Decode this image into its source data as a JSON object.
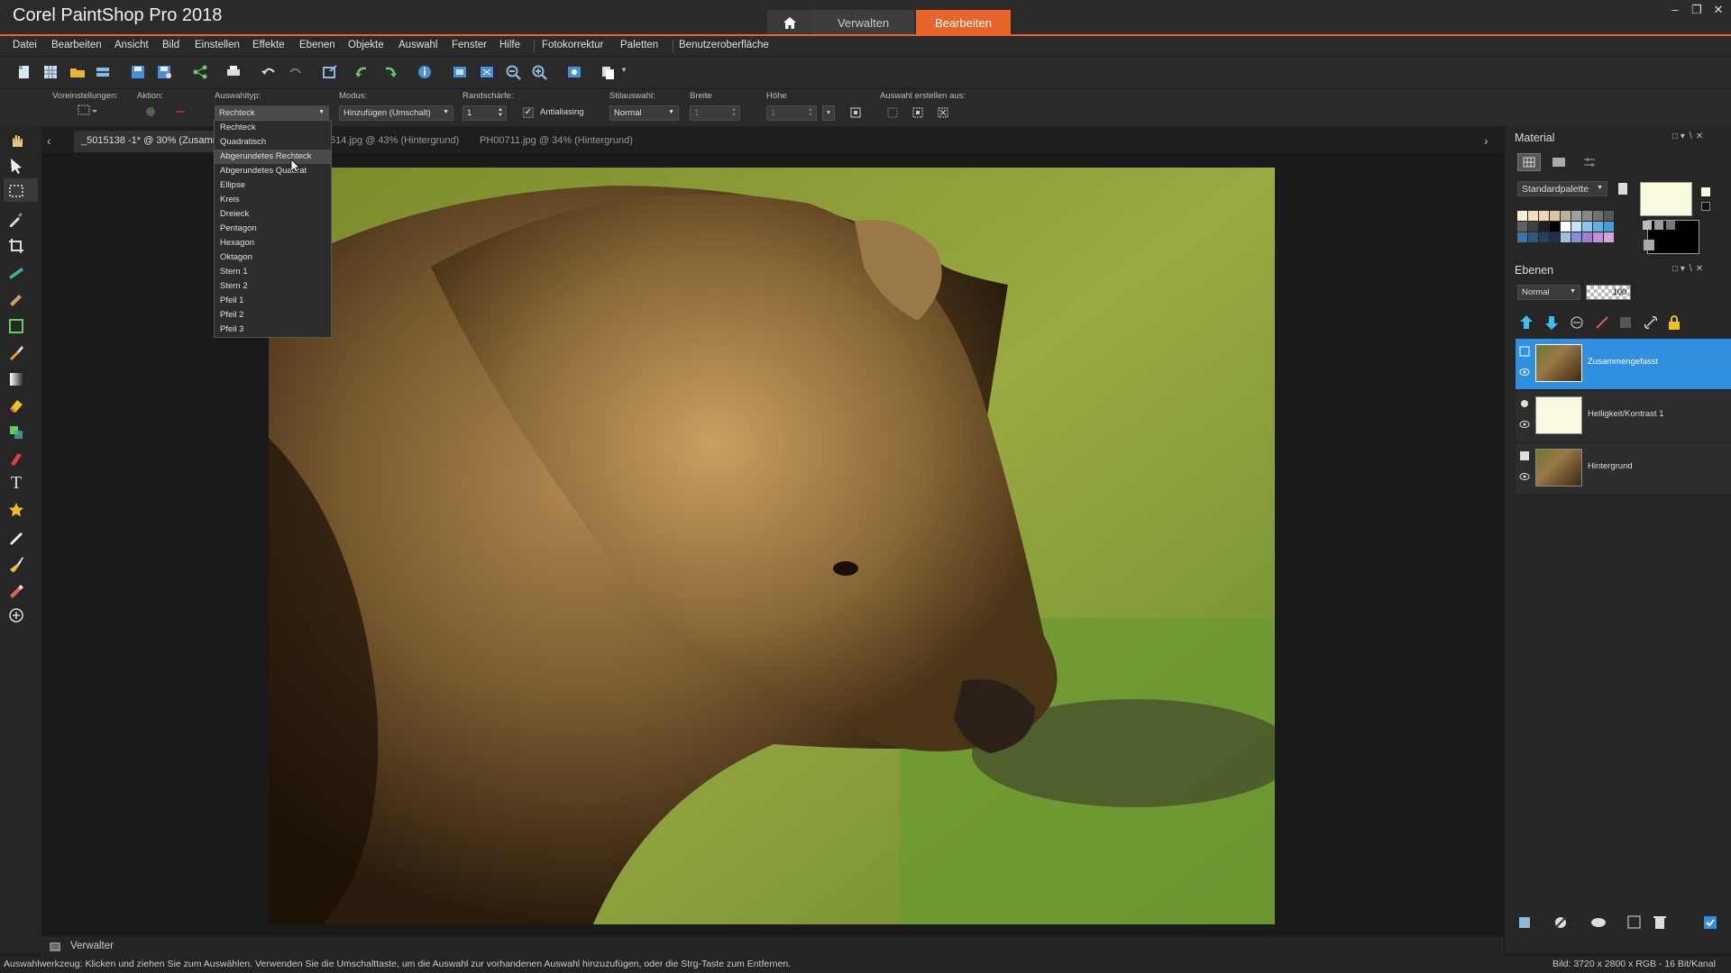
{
  "app": {
    "title": "Corel PaintShop Pro 2018",
    "tabs": {
      "verwalten": "Verwalten",
      "bearbeiten": "Bearbeiten"
    },
    "accent": "#e8642a"
  },
  "menu": [
    "Datei",
    "Bearbeiten",
    "Ansicht",
    "Bild",
    "Einstellen",
    "Effekte",
    "Ebenen",
    "Objekte",
    "Auswahl",
    "Fenster",
    "Hilfe",
    "Fotokorrektur",
    "Paletten",
    "Benutzeroberfläche"
  ],
  "options": {
    "voreinstellungen": "Voreinstellungen:",
    "aktion": "Aktion:",
    "auswahltyp_label": "Auswahltyp:",
    "auswahltyp_value": "Rechteck",
    "modus_label": "Modus:",
    "modus_value": "Hinzufügen (Umschalt)",
    "randschaerfe_label": "Randschärfe:",
    "randschaerfe_value": "1",
    "antialiasing": "Antialiasing",
    "stilauswahl_label": "Stilauswahl:",
    "stilauswahl_value": "Normal",
    "breite_label": "Breite",
    "breite_value": "1",
    "hoehe_label": "Höhe",
    "hoehe_value": "1",
    "auswahl_erstellen": "Auswahl erstellen aus:"
  },
  "dropdown": {
    "items": [
      "Rechteck",
      "Quadratisch",
      "Abgerundetes Rechteck",
      "Abgerundetes Quadrat",
      "Ellipse",
      "Kreis",
      "Dreieck",
      "Pentagon",
      "Hexagon",
      "Oktagon",
      "Stern 1",
      "Stern 2",
      "Pfeil 1",
      "Pfeil 2",
      "Pfeil 3"
    ],
    "highlighted_index": 2
  },
  "doc_tabs": {
    "tab1": "_5015138 -1* @  30% (Zusamm",
    "tab2": "514.jpg @  43% (Hintergrund)",
    "tab3": "PH00711.jpg @  34% (Hintergrund)"
  },
  "material": {
    "title": "Material",
    "palette": "Standardpalette"
  },
  "layers": {
    "title": "Ebenen",
    "blend": "Normal",
    "opacity": "100",
    "items": [
      "Zusammengefasst",
      "Helligkeit/Kontrast 1",
      "Hintergrund"
    ]
  },
  "verwalter": "Verwalter",
  "status": {
    "hint": "Auswahlwerkzeug: Klicken und ziehen Sie zum Auswählen. Verwenden Sie die Umschalttaste, um die Auswahl zur vorhandenen Auswahl hinzuzufügen, oder die Strg-Taste zum Entfernen.",
    "info": "Bild:  3720 x 2800 x RGB - 16 Bit/Kanal"
  }
}
